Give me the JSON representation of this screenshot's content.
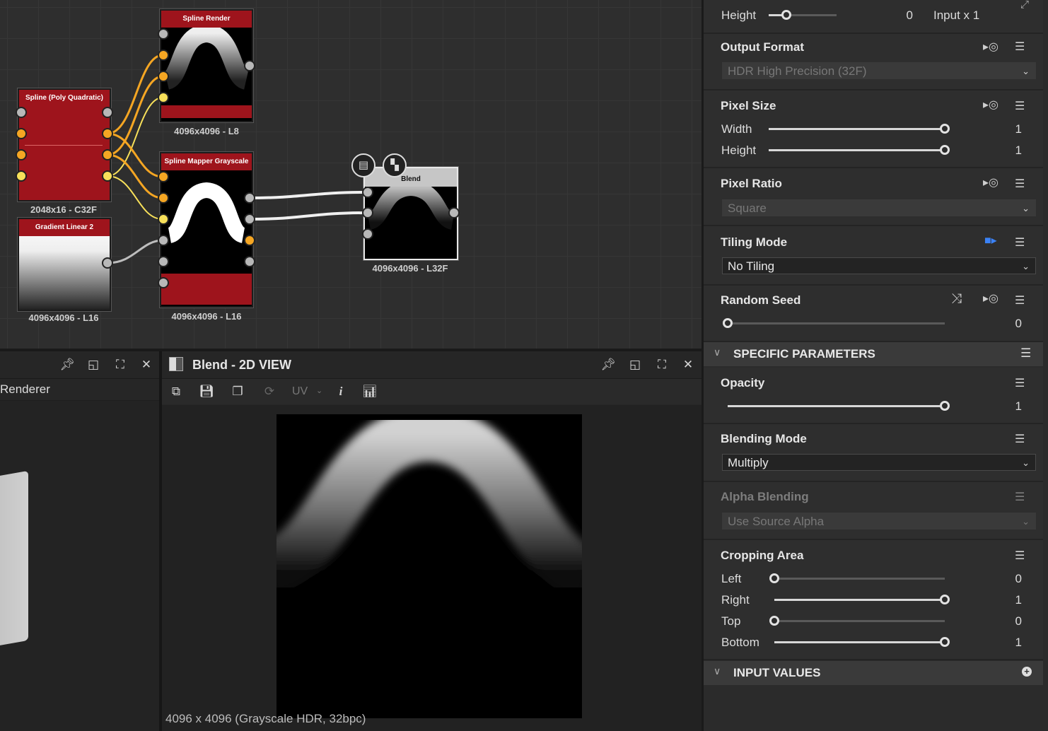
{
  "graph": {
    "nodes": {
      "spline_render": {
        "title": "Spline Render",
        "res": "4096x4096 - L8"
      },
      "spline_poly": {
        "title": "Spline (Poly Quadratic)",
        "res": "2048x16 - C32F"
      },
      "gradient": {
        "title": "Gradient Linear 2",
        "res": "4096x4096 - L16"
      },
      "mapper": {
        "title": "Spline Mapper Grayscale",
        "res": "4096x4096 - L16"
      },
      "blend": {
        "title": "Blend",
        "res": "4096x4096 - L32F"
      }
    }
  },
  "left_panel": {
    "label": "Renderer"
  },
  "view2d": {
    "title": "Blend - 2D VIEW",
    "uv_label": "UV",
    "status": "4096 x 4096 (Grayscale HDR, 32bpc)"
  },
  "props": {
    "top_height": {
      "label": "Height",
      "value": "0",
      "input": "Input x 1",
      "fraction": 0.26
    },
    "output_format": {
      "title": "Output Format",
      "value": "HDR High Precision (32F)"
    },
    "pixel_size": {
      "title": "Pixel Size",
      "width": {
        "label": "Width",
        "value": "1",
        "fraction": 1.0
      },
      "height": {
        "label": "Height",
        "value": "1",
        "fraction": 1.0
      }
    },
    "pixel_ratio": {
      "title": "Pixel Ratio",
      "value": "Square"
    },
    "tiling_mode": {
      "title": "Tiling Mode",
      "value": "No Tiling"
    },
    "random_seed": {
      "title": "Random Seed",
      "value": "0",
      "fraction": 0.0
    },
    "specific_header": "SPECIFIC PARAMETERS",
    "opacity": {
      "title": "Opacity",
      "value": "1",
      "fraction": 1.0
    },
    "blending_mode": {
      "title": "Blending Mode",
      "value": "Multiply"
    },
    "alpha_blending": {
      "title": "Alpha Blending",
      "value": "Use Source Alpha"
    },
    "cropping": {
      "title": "Cropping Area",
      "left": {
        "label": "Left",
        "value": "0",
        "fraction": 0.0
      },
      "right": {
        "label": "Right",
        "value": "1",
        "fraction": 1.0
      },
      "top": {
        "label": "Top",
        "value": "0",
        "fraction": 0.0
      },
      "bottom": {
        "label": "Bottom",
        "value": "1",
        "fraction": 1.0
      }
    },
    "input_header": "INPUT VALUES"
  },
  "colors": {
    "node_title_red": "#9e141c",
    "port_orange": "#f5a623",
    "port_yellow": "#f7e05a"
  }
}
